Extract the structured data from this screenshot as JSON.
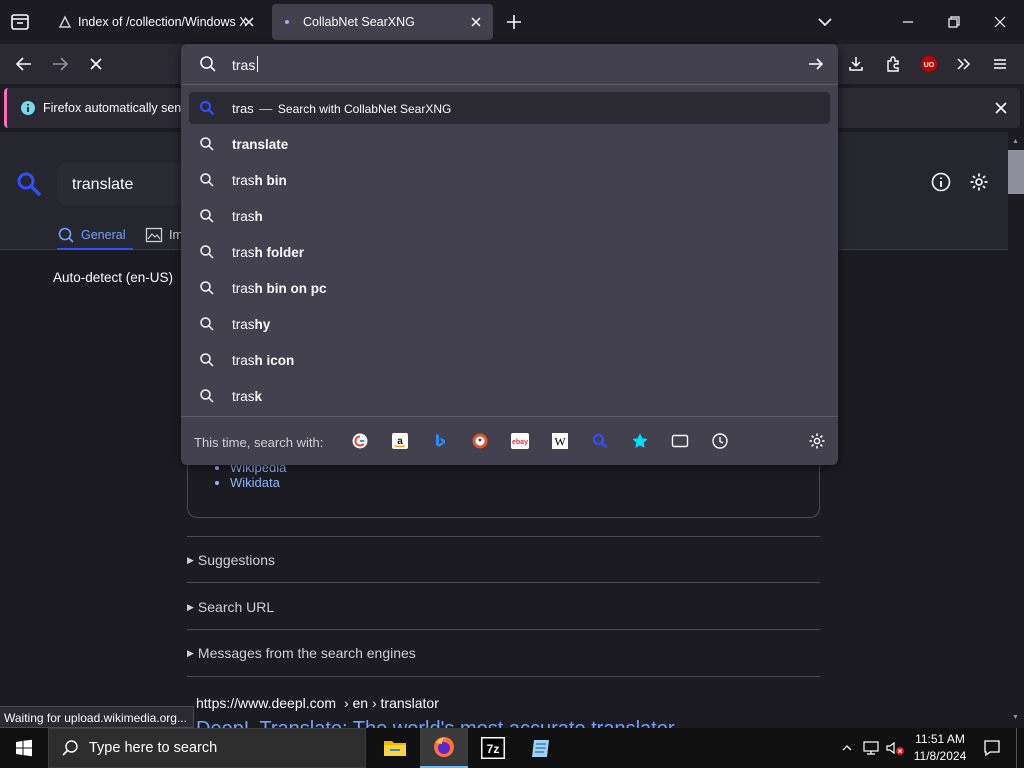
{
  "browser": {
    "tabs": [
      {
        "title": "Index of /collection/Windows X"
      },
      {
        "title": "CollabNet SearXNG"
      }
    ],
    "url_input": "tras",
    "notification": "Firefox automatically sends"
  },
  "search_page": {
    "query": "translate",
    "tabs": [
      "General",
      "Im"
    ],
    "language": "Auto-detect (en-US)",
    "infobox_links": [
      "Wikipedia",
      "Wikidata"
    ],
    "sections": [
      "Suggestions",
      "Search URL",
      "Messages from the search engines"
    ],
    "result_url": "https://www.deepl.com",
    "result_path": "› en › translator",
    "result_title": "DeepL Translate: The world's most accurate translator"
  },
  "urlbar_dropdown": {
    "first_row": {
      "typed": "tras",
      "separator": "—",
      "action": "Search with CollabNet SearXNG"
    },
    "suggestions": [
      {
        "typed": "",
        "completion": "translate"
      },
      {
        "typed": "tras",
        "completion": "h bin"
      },
      {
        "typed": "tras",
        "completion": "h"
      },
      {
        "typed": "tras",
        "completion": "h folder"
      },
      {
        "typed": "tras",
        "completion": "h bin on pc"
      },
      {
        "typed": "tras",
        "completion": "hy"
      },
      {
        "typed": "tras",
        "completion": "h icon"
      },
      {
        "typed": "tras",
        "completion": "k"
      }
    ],
    "search_with_label": "This time, search with:",
    "engines": [
      "google-icon",
      "amazon-icon",
      "bing-icon",
      "duckduckgo-icon",
      "ebay-icon",
      "wikipedia-icon",
      "searxng-icon",
      "bookmarks-icon",
      "tabs-icon",
      "history-icon"
    ]
  },
  "status_text": "Waiting for upload.wikimedia.org...",
  "taskbar": {
    "search_placeholder": "Type here to search",
    "time": "11:51 AM",
    "date": "11/8/2024"
  },
  "colors": {
    "accent": "#0060df",
    "tab_active": "#42414d",
    "searx_blue": "#3050ff",
    "link": "#8ab4f8"
  }
}
